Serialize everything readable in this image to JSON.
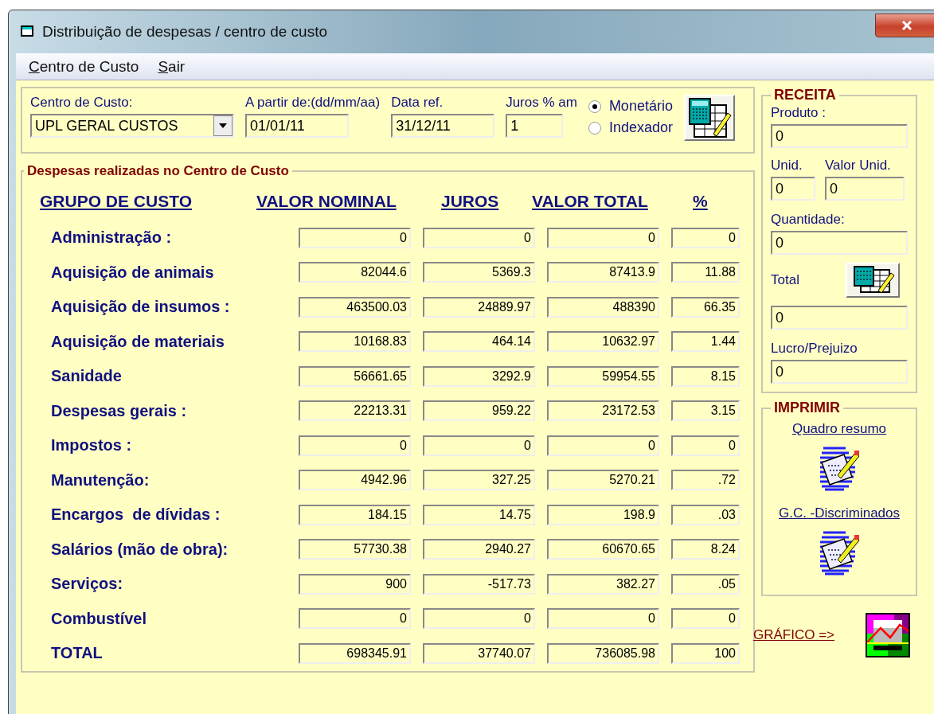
{
  "window": {
    "title": "Distribuição de despesas / centro de custo"
  },
  "menu": [
    {
      "label": "Centro de Custo"
    },
    {
      "label": "Sair"
    }
  ],
  "filters": {
    "cost_center": {
      "label": "Centro de Custo:",
      "value": "UPL GERAL CUSTOS"
    },
    "start_date": {
      "label": "A partir de:(dd/mm/aa)",
      "value": "01/01/11"
    },
    "ref_date": {
      "label": "Data ref.",
      "value": "31/12/11"
    },
    "interest": {
      "label": "Juros % am",
      "value": "1"
    },
    "modes": [
      {
        "label": "Monetário",
        "selected": true
      },
      {
        "label": "Indexador",
        "selected": false
      }
    ]
  },
  "expenses": {
    "title": "Despesas realizadas no Centro de Custo",
    "columns": [
      "GRUPO DE CUSTO",
      "VALOR NOMINAL",
      "JUROS",
      "VALOR TOTAL",
      "%"
    ],
    "rows": [
      {
        "label": "Administração :",
        "values": [
          "0",
          "0",
          "0",
          "0"
        ]
      },
      {
        "label": "Aquisição de animais",
        "values": [
          "82044.6",
          "5369.3",
          "87413.9",
          "11.88"
        ]
      },
      {
        "label": "Aquisição de insumos :",
        "values": [
          "463500.03",
          "24889.97",
          "488390",
          "66.35"
        ]
      },
      {
        "label": "Aquisição de materiais",
        "values": [
          "10168.83",
          "464.14",
          "10632.97",
          "1.44"
        ]
      },
      {
        "label": "Sanidade",
        "values": [
          "56661.65",
          "3292.9",
          "59954.55",
          "8.15"
        ]
      },
      {
        "label": "Despesas gerais :",
        "values": [
          "22213.31",
          "959.22",
          "23172.53",
          "3.15"
        ]
      },
      {
        "label": "Impostos :",
        "values": [
          "0",
          "0",
          "0",
          "0"
        ]
      },
      {
        "label": "Manutenção:",
        "values": [
          "4942.96",
          "327.25",
          "5270.21",
          ".72"
        ]
      },
      {
        "label": "Encargos  de dívidas :",
        "values": [
          "184.15",
          "14.75",
          "198.9",
          ".03"
        ]
      },
      {
        "label": "Salários (mão de obra):",
        "values": [
          "57730.38",
          "2940.27",
          "60670.65",
          "8.24"
        ]
      },
      {
        "label": "Serviços:",
        "values": [
          "900",
          "-517.73",
          "382.27",
          ".05"
        ]
      },
      {
        "label": "Combustível",
        "values": [
          "0",
          "0",
          "0",
          "0"
        ]
      },
      {
        "label": "TOTAL",
        "values": [
          "698345.91",
          "37740.07",
          "736085.98",
          "100"
        ]
      }
    ]
  },
  "receita": {
    "title": "RECEITA",
    "produto": {
      "label": "Produto :",
      "value": "0"
    },
    "unid": {
      "label": "Unid.",
      "value": "0"
    },
    "valor_unid": {
      "label": "Valor Unid.",
      "value": "0"
    },
    "quantidade": {
      "label": "Quantidade:",
      "value": "0"
    },
    "total": {
      "label": "Total",
      "value": "0"
    },
    "lucro": {
      "label": "Lucro/Prejuizo",
      "value": "0"
    }
  },
  "imprimir": {
    "title": "IMPRIMIR",
    "links": [
      "Quadro resumo",
      "G.C. -Discriminados"
    ]
  },
  "grafico": {
    "label": "GRÁFICO =>"
  }
}
